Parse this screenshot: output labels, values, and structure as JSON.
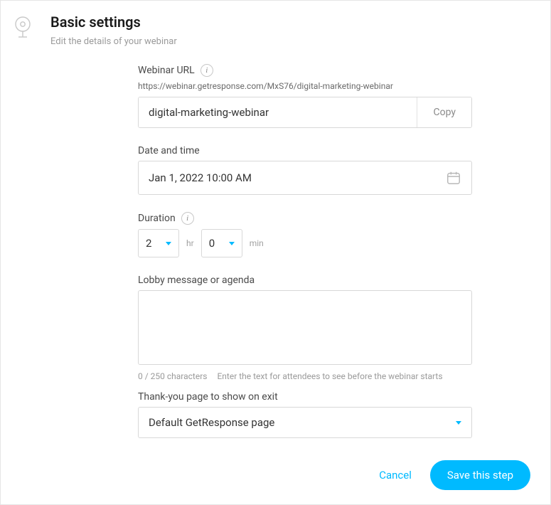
{
  "header": {
    "title": "Basic settings",
    "subtitle": "Edit the details of your webinar"
  },
  "url": {
    "label": "Webinar URL",
    "preview": "https://webinar.getresponse.com/MxS76/digital-marketing-webinar",
    "value": "digital-marketing-webinar",
    "copy_label": "Copy"
  },
  "datetime": {
    "label": "Date and time",
    "value": "Jan 1, 2022 10:00 AM"
  },
  "duration": {
    "label": "Duration",
    "hours": "2",
    "minutes": "0",
    "hr_unit": "hr",
    "min_unit": "min"
  },
  "lobby": {
    "label": "Lobby message or agenda",
    "value": "",
    "counter": "0 / 250 characters",
    "hint": "Enter the text for attendees to see before the webinar starts"
  },
  "thankyou": {
    "label": "Thank-you page to show on exit",
    "value": "Default GetResponse page"
  },
  "footer": {
    "cancel": "Cancel",
    "save": "Save this step"
  }
}
